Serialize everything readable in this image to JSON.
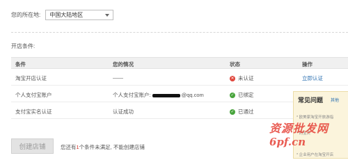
{
  "location": {
    "label": "您的所在地:",
    "selected": "中国大陆地区"
  },
  "conditions_title": "开店条件:",
  "table": {
    "headers": [
      "条件",
      "您的情况",
      "状态",
      "操作"
    ],
    "rows": [
      {
        "condition": "淘宝开店认证",
        "situation": "——",
        "status": "未认证",
        "status_type": "fail",
        "action": "立即认证"
      },
      {
        "condition": "个人支付宝账户",
        "situation_prefix": "个人支付宝账户:",
        "situation_suffix": "@qq.com",
        "status": "已绑定",
        "status_type": "ok",
        "action": ""
      },
      {
        "condition": "支付宝实名认证",
        "situation": "认证成功",
        "status": "已通过",
        "status_type": "ok",
        "action": ""
      }
    ]
  },
  "create_button": "创建店铺",
  "note": {
    "prefix": "您还有",
    "count": "1",
    "suffix": "个条件未满足, 不能创建店铺"
  },
  "faq": {
    "title": "常见问题",
    "more": "其他",
    "items": [
      "* 欧美家淘宝开旅游指",
      "* 的宝贝",
      "* 企业用户在淘宝开店"
    ]
  },
  "watermark": {
    "line1": "资源批发网",
    "line2": "6pf.cn"
  },
  "colors": {
    "fail": "#e0463c",
    "ok": "#48a43c",
    "link": "#2a6fb0",
    "watermark": "#e6463c"
  }
}
